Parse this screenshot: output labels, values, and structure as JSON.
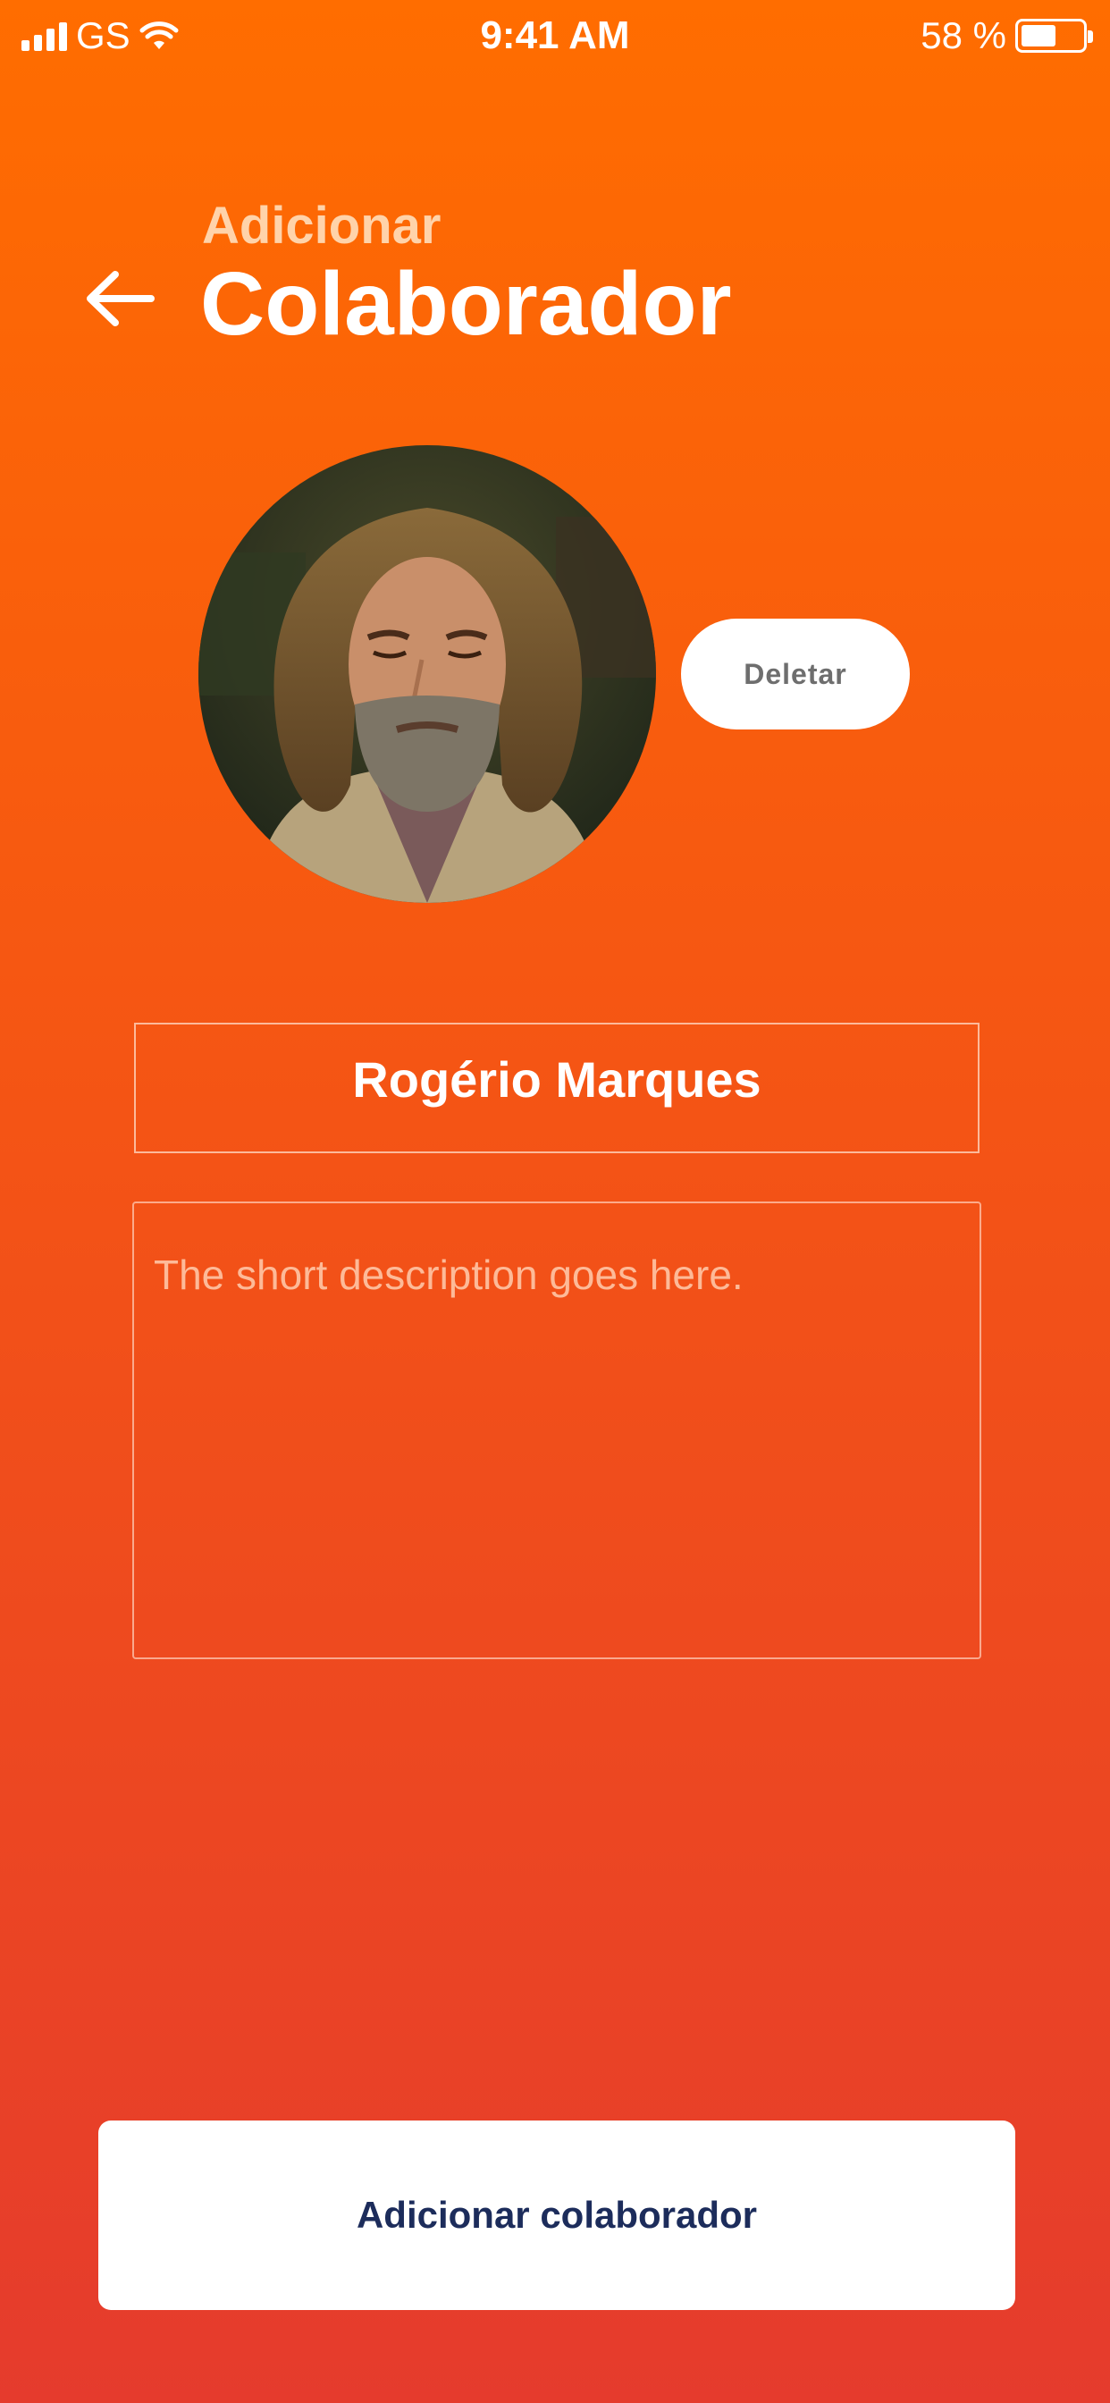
{
  "status_bar": {
    "carrier": "GS",
    "time": "9:41 AM",
    "battery_percent": "58 %",
    "battery_level": 0.58
  },
  "header": {
    "subtitle": "Adicionar",
    "title": "Colaborador"
  },
  "profile": {
    "delete_label": "Deletar"
  },
  "form": {
    "name_value": "Rogério Marques",
    "description_value": "",
    "description_placeholder": "The short description goes here."
  },
  "actions": {
    "add_label": "Adicionar colaborador"
  },
  "colors": {
    "gradient_top": "#FF6D00",
    "gradient_bottom": "#E53B2D",
    "button_text": "#1C2C5B",
    "delete_text": "#6E6E6E"
  }
}
